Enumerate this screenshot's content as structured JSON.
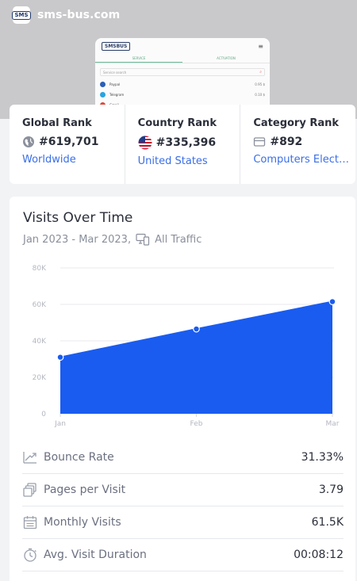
{
  "site": {
    "name": "sms-bus.com",
    "favicon_text": "SMS"
  },
  "preview": {
    "logo": "SMSBUS",
    "tabs": [
      "SERVICE",
      "ACTIVATION"
    ],
    "search_placeholder": "Service search",
    "rows": [
      {
        "name": "Paypal",
        "value": "0.95 $",
        "color": "#2c5fb8"
      },
      {
        "name": "Telegram",
        "value": "0.10 $",
        "color": "#2aa3de"
      },
      {
        "name": "Gmail",
        "value": "",
        "color": "#d94b3d"
      }
    ]
  },
  "ranks": {
    "global": {
      "title": "Global Rank",
      "value": "#619,701",
      "link": "Worldwide",
      "icon": "globe-icon"
    },
    "country": {
      "title": "Country Rank",
      "value": "#335,396",
      "link": "United States",
      "icon": "us-flag-icon"
    },
    "category": {
      "title": "Category Rank",
      "value": "#892",
      "link": "Computers Electronics and Technology",
      "icon": "category-icon"
    }
  },
  "visits": {
    "title": "Visits Over Time",
    "period": "Jan 2023 - Mar 2023,",
    "traffic": "All Traffic"
  },
  "chart_data": {
    "type": "area",
    "categories": [
      "Jan",
      "Feb",
      "Mar"
    ],
    "values": [
      31000,
      46500,
      61500
    ],
    "y_ticks": [
      0,
      20000,
      40000,
      60000,
      80000
    ],
    "y_tick_labels": [
      "0",
      "20K",
      "40K",
      "60K",
      "80K"
    ],
    "ylim": [
      0,
      80000
    ],
    "color": "#1a5cf0",
    "grid": true
  },
  "metrics": [
    {
      "label": "Bounce Rate",
      "value": "31.33%",
      "icon": "bounce-icon"
    },
    {
      "label": "Pages per Visit",
      "value": "3.79",
      "icon": "pages-icon"
    },
    {
      "label": "Monthly Visits",
      "value": "61.5K",
      "icon": "calendar-icon"
    },
    {
      "label": "Avg. Visit Duration",
      "value": "00:08:12",
      "icon": "timer-icon"
    }
  ]
}
